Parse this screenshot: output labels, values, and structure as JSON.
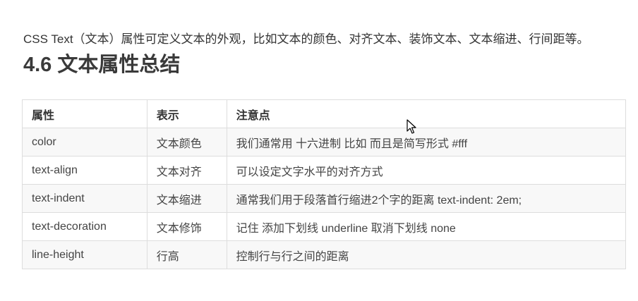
{
  "intro": {
    "text": "CSS Text（文本）属性可定义文本的外观，比如文本的颜色、对齐文本、装饰文本、文本缩进、行间距等。"
  },
  "section": {
    "title": "4.6 文本属性总结"
  },
  "table": {
    "headers": [
      "属性",
      "表示",
      "注意点"
    ],
    "rows": [
      [
        "color",
        "文本颜色",
        "我们通常用  十六进制   比如 而且是简写形式 #fff"
      ],
      [
        "text-align",
        "文本对齐",
        "可以设定文字水平的对齐方式"
      ],
      [
        "text-indent",
        "文本缩进",
        "通常我们用于段落首行缩进2个字的距离   text-indent: 2em;"
      ],
      [
        "text-decoration",
        "文本修饰",
        "记住 添加下划线  underline  取消下划线  none"
      ],
      [
        "line-height",
        "行高",
        "控制行与行之间的距离"
      ]
    ]
  },
  "colors": {
    "text": "#333333",
    "border": "#dddddd",
    "row_stripe": "#f8f8f8"
  },
  "icons": {
    "cursor": "mouse-pointer-icon"
  }
}
